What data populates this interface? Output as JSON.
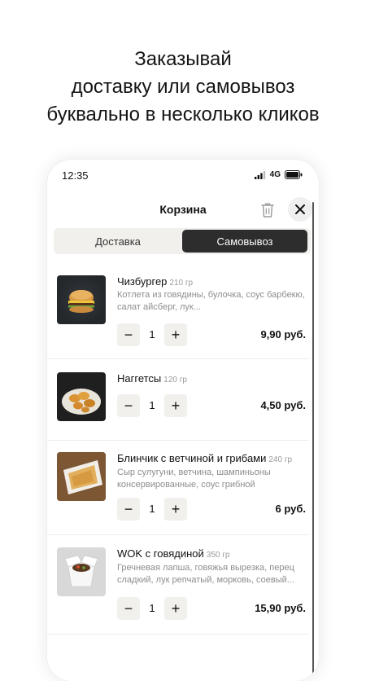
{
  "headline": {
    "line1": "Заказывай",
    "line2": "доставку или самовывоз",
    "line3": "буквально в несколько кликов"
  },
  "status_bar": {
    "time": "12:35",
    "network": "4G"
  },
  "cart": {
    "title": "Корзина",
    "tabs": [
      {
        "label": "Доставка",
        "selected": false
      },
      {
        "label": "Самовывоз",
        "selected": true
      }
    ],
    "items": [
      {
        "name": "Чизбургер",
        "weight": "210 гр",
        "description": "Котлета из говядины, булочка, соус барбекю, салат айсберг, лук...",
        "quantity": "1",
        "price": "9,90 руб.",
        "image_icon": "burger-image"
      },
      {
        "name": "Наггетсы",
        "weight": "120 гр",
        "description": "",
        "quantity": "1",
        "price": "4,50 руб.",
        "image_icon": "nuggets-image"
      },
      {
        "name": "Блинчик с ветчиной и грибами",
        "weight": "240 гр",
        "description": "Сыр сулугуни, ветчина, шампиньоны консервированные, соус грибной",
        "quantity": "1",
        "price": "6 руб.",
        "image_icon": "pancake-image"
      },
      {
        "name": "WOK с говядиной",
        "weight": "350 гр",
        "description": "Гречневая лапша, говяжья вырезка, перец сладкий, лук репчатый, морковь, соевый...",
        "quantity": "1",
        "price": "15,90 руб.",
        "image_icon": "wok-box-image"
      }
    ],
    "stepper": {
      "minus": "−",
      "plus": "+"
    }
  },
  "colors": {
    "accent_dark": "#2d2d2d",
    "button_bg": "#f2f0ec",
    "muted_text": "#8d8d8d"
  }
}
